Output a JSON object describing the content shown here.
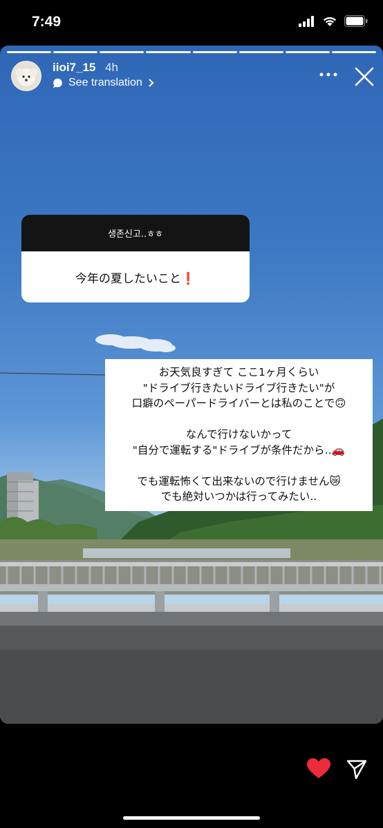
{
  "status_bar": {
    "time": "7:49"
  },
  "story": {
    "username": "iioi7_15",
    "time_ago": "4h",
    "translate_label": "See translation",
    "progress_segments": 8,
    "progress_done": 8
  },
  "question_sticker": {
    "header": "생존신고..ㅎㅎ",
    "answer": "今年の夏したいこと❗"
  },
  "answer_text": {
    "lines": [
      "お天気良すぎて ここ1ヶ月くらい",
      "\"ドライブ行きたいドライブ行きたい\"が",
      "口癖のペーパードライバーとは私のことで🙃",
      "",
      "なんで行けないかって",
      "\"自分で運転する\"ドライブが条件だから‥🚗",
      "",
      "でも運転怖くて出来ないので行けません😿",
      "でも絶対いつかは行ってみたい.."
    ]
  },
  "colors": {
    "like": "#ed2b3a",
    "sky": "#3c78c4"
  },
  "icons": {
    "signal": "cellular-signal-icon",
    "wifi": "wifi-icon",
    "battery": "battery-icon",
    "more": "more-options-icon",
    "close": "close-icon",
    "like": "heart-icon",
    "send": "send-icon"
  }
}
